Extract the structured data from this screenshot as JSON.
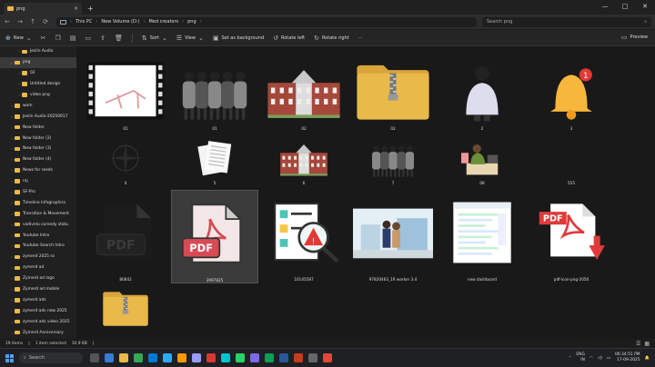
{
  "tab": {
    "title": "png"
  },
  "address": {
    "crumbs": [
      "This PC",
      "New Volume (D:)",
      "Med creators",
      "png"
    ],
    "search_placeholder": "Search png"
  },
  "toolbar": {
    "new": "New",
    "sort": "Sort",
    "view": "View",
    "set_bg": "Set as background",
    "rotate_left": "Rotate left",
    "rotate_right": "Rotate right",
    "more": "···",
    "preview": "Preview"
  },
  "sidebar": {
    "items": [
      {
        "label": "Jeslin Audio",
        "level": 1
      },
      {
        "label": "png",
        "level": 0,
        "selected": true
      },
      {
        "label": "02",
        "level": 1
      },
      {
        "label": "Untitled design",
        "level": 1
      },
      {
        "label": "video png",
        "level": 1
      },
      {
        "label": "work",
        "level": 0
      },
      {
        "label": "Jeslin Audio-20250917",
        "level": 0
      },
      {
        "label": "New folder",
        "level": 0
      },
      {
        "label": "New folder (2)",
        "level": 0
      },
      {
        "label": "New folder (3)",
        "level": 0
      },
      {
        "label": "New folder (4)",
        "level": 0
      },
      {
        "label": "News for reeds",
        "level": 0
      },
      {
        "label": "raj",
        "level": 0
      },
      {
        "label": "SF-Pro",
        "level": 0
      },
      {
        "label": "Timeline Infographics",
        "level": 0
      },
      {
        "label": "Transition & Movement",
        "level": 0
      },
      {
        "label": "vadivelu comedy statu",
        "level": 0
      },
      {
        "label": "Youtube Intro",
        "level": 0
      },
      {
        "label": "Youtube Search Intro",
        "level": 0
      },
      {
        "label": "zymerd 2025 ss",
        "level": 0
      },
      {
        "label": "zymerd ad",
        "level": 0
      },
      {
        "label": "Zymerd ad logo",
        "level": 0
      },
      {
        "label": "Zymerd ad mobile",
        "level": 0
      },
      {
        "label": "zymerd ads",
        "level": 0
      },
      {
        "label": "zymerd ads new 2025",
        "level": 0
      },
      {
        "label": "zymerd ads video 2025",
        "level": 0
      },
      {
        "label": "Zymerd Anniversary",
        "level": 0
      }
    ]
  },
  "files": [
    {
      "name": "01",
      "kind": "video-sketch"
    },
    {
      "name": "01",
      "kind": "people"
    },
    {
      "name": "02",
      "kind": "building"
    },
    {
      "name": "02",
      "kind": "zip-folder"
    },
    {
      "name": "2",
      "kind": "person-back"
    },
    {
      "name": "3",
      "kind": "bell"
    },
    {
      "name": "4",
      "kind": "compass"
    },
    {
      "name": "5",
      "kind": "papers"
    },
    {
      "name": "6",
      "kind": "building"
    },
    {
      "name": "7",
      "kind": "people"
    },
    {
      "name": "08",
      "kind": "man-desk"
    },
    {
      "name": "555",
      "kind": "blank"
    },
    {
      "name": "80842",
      "kind": "pdf-dark"
    },
    {
      "name": "3997825",
      "kind": "pdf-light"
    },
    {
      "name": "10145587",
      "kind": "warning-doc"
    },
    {
      "name": "97820463_1R worker 3.4",
      "kind": "city-people"
    },
    {
      "name": "new dashboard",
      "kind": "dashboard"
    },
    {
      "name": "pdf-icon-png-2050",
      "kind": "pdf-red"
    },
    {
      "name": "",
      "kind": "zip-folder"
    }
  ],
  "status": {
    "count": "19 items",
    "selection": "1 item selected",
    "size": "10.9 KB"
  },
  "taskbar": {
    "search": "Search",
    "lang": "ENG",
    "lang2": "IN",
    "time": "06:34:51 PM",
    "date": "17-09-2025"
  },
  "colors": {
    "folder": "#e9b949",
    "pdf_red": "#e03a3a",
    "accent": "#4aa3ff"
  }
}
